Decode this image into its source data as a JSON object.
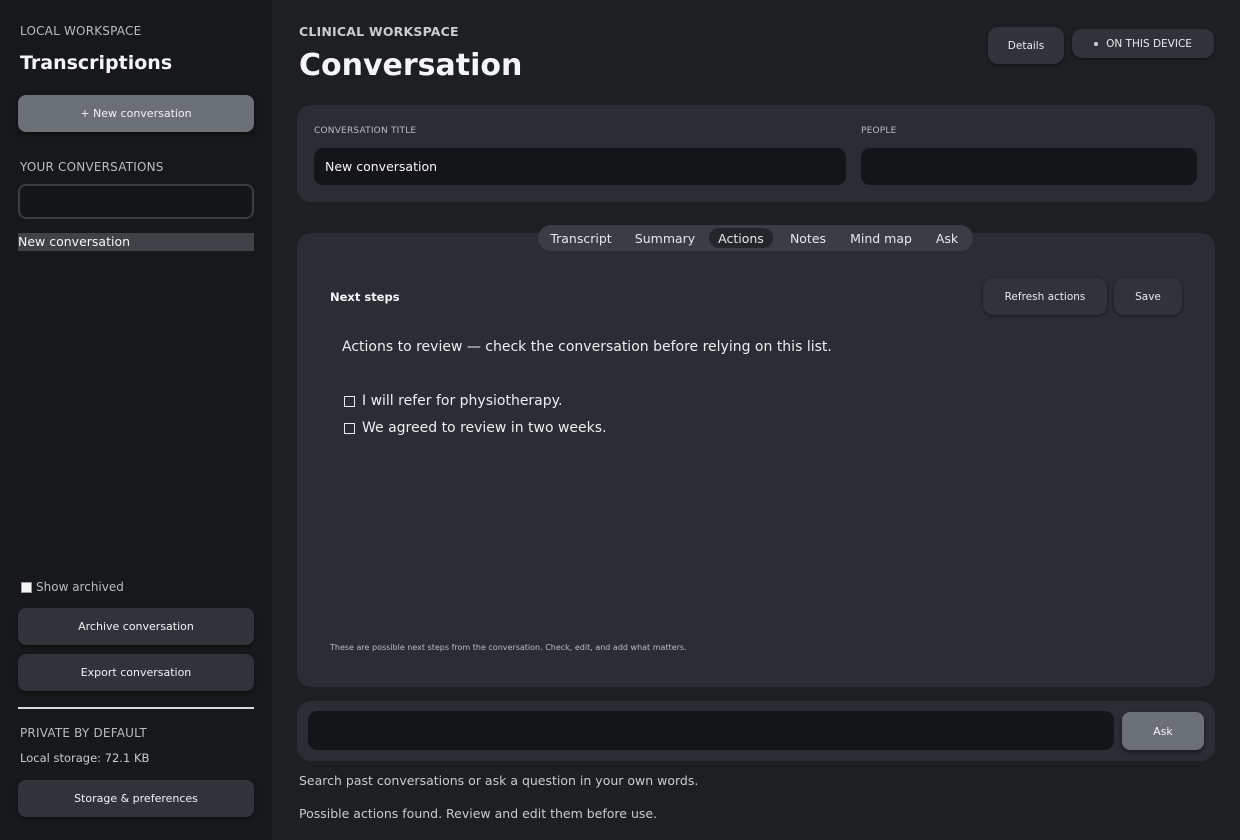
{
  "sidebar": {
    "eyebrow": "LOCAL WORKSPACE",
    "title": "Transcriptions",
    "new_conversation_label": "+ New conversation",
    "your_conversations_label": "YOUR CONVERSATIONS",
    "search_value": "",
    "conversations": [
      {
        "label": "New conversation",
        "selected": true
      }
    ],
    "show_archived_label": "Show archived",
    "show_archived_checked": false,
    "archive_label": "Archive conversation",
    "export_label": "Export conversation",
    "private_label": "PRIVATE BY DEFAULT",
    "storage_text": "Local storage: 72.1 KB",
    "storage_prefs_label": "Storage & preferences"
  },
  "header": {
    "eyebrow": "CLINICAL WORKSPACE",
    "title": "Conversation",
    "details_label": "Details",
    "device_badge": "ON THIS DEVICE"
  },
  "form": {
    "title_label": "CONVERSATION TITLE",
    "title_value": "New conversation",
    "people_label": "PEOPLE",
    "people_value": ""
  },
  "tabs": [
    {
      "label": "Transcript",
      "active": false
    },
    {
      "label": "Summary",
      "active": false
    },
    {
      "label": "Actions",
      "active": true
    },
    {
      "label": "Notes",
      "active": false
    },
    {
      "label": "Mind map",
      "active": false
    },
    {
      "label": "Ask",
      "active": false
    }
  ],
  "actions_panel": {
    "title": "Next steps",
    "refresh_label": "Refresh actions",
    "save_label": "Save",
    "intro": "Actions to review — check the conversation before relying on this list.",
    "items": [
      {
        "text": "I will refer for physiotherapy.",
        "checked": false
      },
      {
        "text": "We agreed to review in two weeks.",
        "checked": false
      }
    ],
    "hint": "These are possible next steps from the conversation. Check, edit, and add what matters."
  },
  "ask": {
    "input_value": "",
    "button_label": "Ask",
    "helper": "Search past conversations or ask a question in your own words.",
    "status": "Possible actions found. Review and edit them before use."
  },
  "colors": {
    "background": "#1d1f23",
    "sidebar": "#16181b",
    "card": "#2a2d33",
    "primary_button": "#6b7077",
    "dark_button": "#30333a"
  }
}
